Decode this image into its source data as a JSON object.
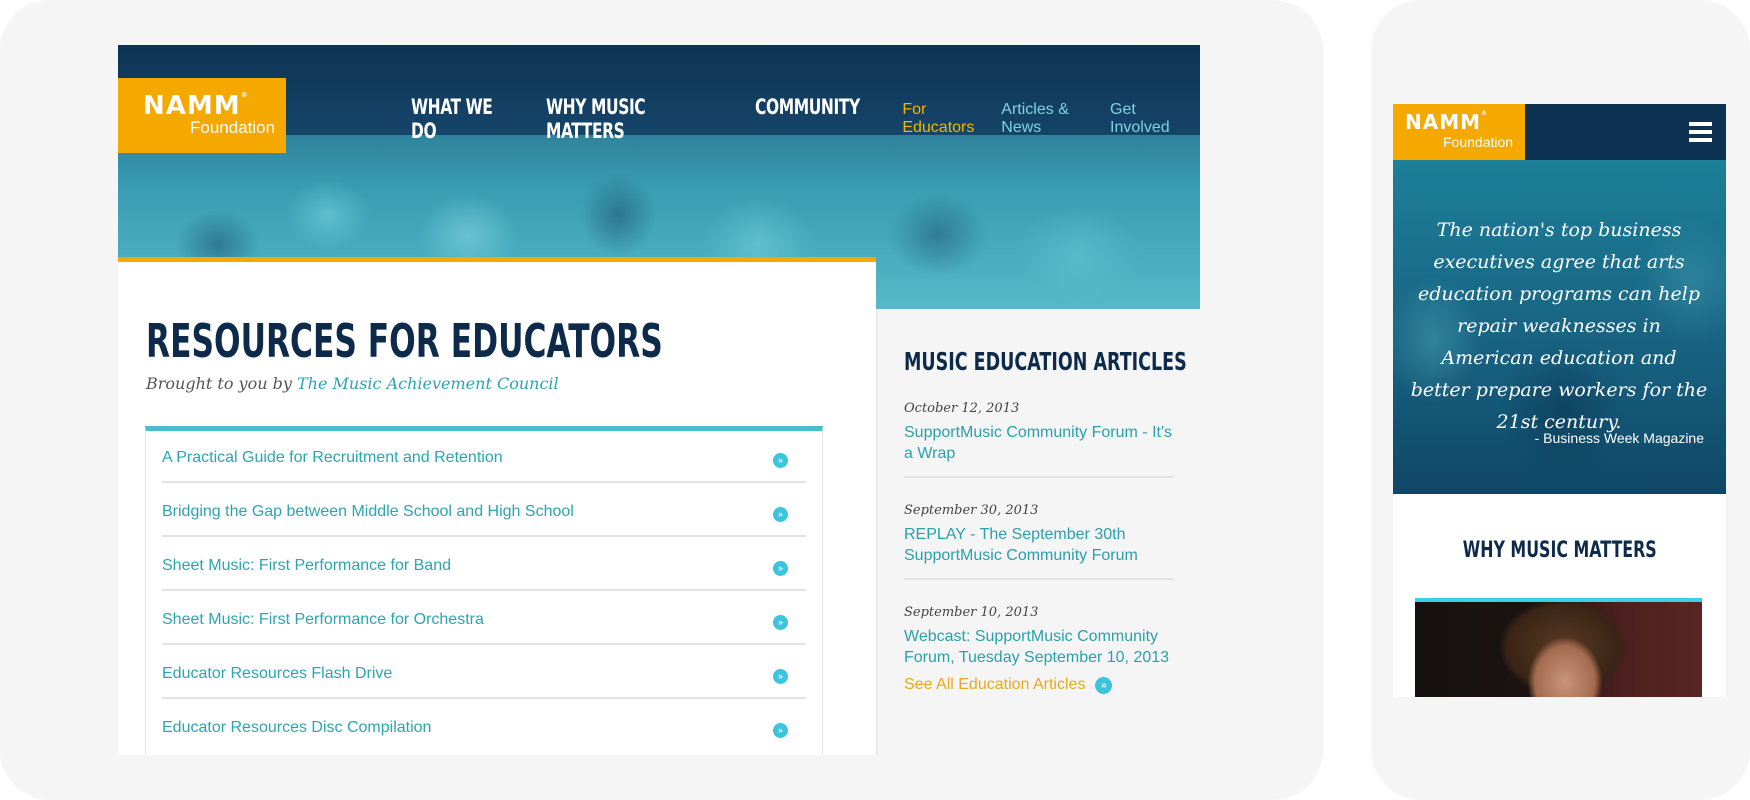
{
  "desktop": {
    "logo": {
      "line1": "NAMM",
      "registered": "®",
      "line2": "Foundation"
    },
    "nav": {
      "primary": [
        "WHAT WE DO",
        "WHY MUSIC MATTERS",
        "COMMUNITY"
      ],
      "secondary": [
        {
          "label": "For Educators",
          "active": true
        },
        {
          "label": "Articles & News",
          "active": false
        },
        {
          "label": "Get Involved",
          "active": false
        }
      ]
    },
    "page_title": "RESOURCES FOR EDUCATORS",
    "subtitle_prefix": "Brought to you by",
    "subtitle_link": "The Music Achievement Council",
    "resources": [
      "A Practical Guide for Recruitment and Retention",
      "Bridging the Gap between Middle School and High School",
      "Sheet Music: First Performance for Band",
      "Sheet Music: First Performance for Orchestra",
      "Educator Resources Flash Drive",
      "Educator Resources Disc Compilation"
    ],
    "chevron_glyph": "»",
    "sidebar": {
      "title": "MUSIC EDUCATION ARTICLES",
      "articles": [
        {
          "date": "October 12, 2013",
          "title": "SupportMusic Community Forum - It's a Wrap"
        },
        {
          "date": "September 30, 2013",
          "title": "REPLAY - The September 30th SupportMusic Community Forum"
        },
        {
          "date": "September 10, 2013",
          "title": "Webcast: SupportMusic Community Forum, Tuesday September 10, 2013"
        }
      ],
      "see_all": "See All Education Articles"
    }
  },
  "mobile": {
    "logo": {
      "line1": "NAMM",
      "registered": "®",
      "line2": "Foundation"
    },
    "menu_icon": "hamburger-icon",
    "quote": "The nation's top business executives agree that arts education programs can help repair weaknesses in American education and better prepare workers for the 21st century.",
    "quote_source": "- Business Week Magazine",
    "section_title": "WHY MUSIC MATTERS"
  },
  "colors": {
    "brand_gold": "#f5a800",
    "navy": "#0d2a4a",
    "teal_link": "#2aa6b1",
    "accent_cyan": "#3bc4dc"
  }
}
